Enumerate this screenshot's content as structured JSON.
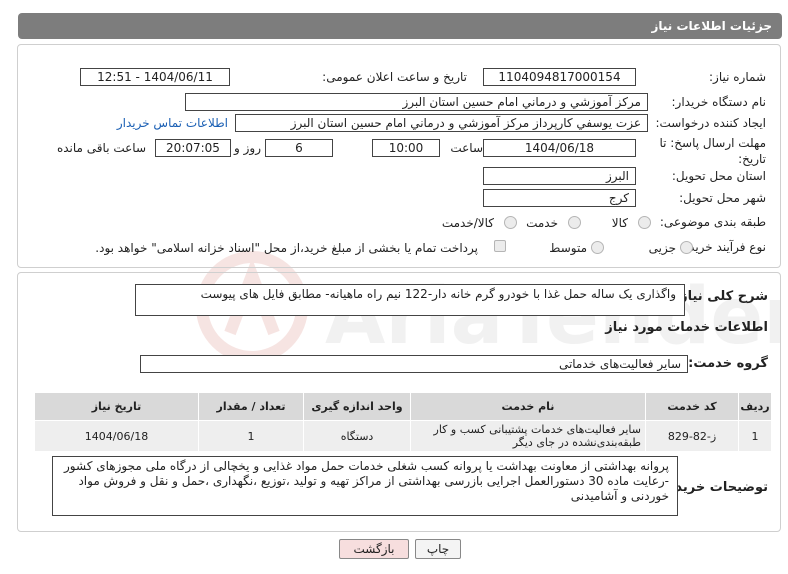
{
  "header": {
    "title": "جزئیات اطلاعات نیاز"
  },
  "fields": {
    "need_number_label": "شماره نیاز:",
    "need_number": "1104094817000154",
    "announce_label": "تاریخ و ساعت اعلان عمومی:",
    "announce_value": "1404/06/11 - 12:51",
    "buyer_org_label": "نام دستگاه خریدار:",
    "buyer_org": "مرکز آموزشي و درماني امام حسين استان البرز",
    "requester_label": "ایجاد کننده درخواست:",
    "requester": "عزت يوسفي كارپرداز مرکز آموزشي و درماني امام حسين استان البرز",
    "contact_link": "اطلاعات تماس خریدار",
    "deadline_label": "مهلت ارسال پاسخ: تا تاریخ:",
    "deadline_date": "1404/06/18",
    "time_label": "ساعت",
    "deadline_time": "10:00",
    "days_value": "6",
    "days_label": "روز و",
    "remaining_time": "20:07:05",
    "remaining_label": "ساعت باقی مانده",
    "province_label": "استان محل تحویل:",
    "province": "البرز",
    "city_label": "شهر محل تحویل:",
    "city": "کرج",
    "category_label": "طبقه بندی موضوعی:",
    "category_options": [
      "کالا",
      "خدمت",
      "کالا/خدمت"
    ],
    "process_label": "نوع فرآیند خرید :",
    "process_options": [
      "جزیی",
      "متوسط"
    ],
    "payment_note": "پرداخت تمام یا بخشی از مبلغ خرید،از محل \"اسناد خزانه اسلامی\" خواهد بود."
  },
  "summary": {
    "label": "شرح کلی نیاز:",
    "text": "واگذاری یک ساله حمل غذا با خودرو گرم خانه دار-122 نیم راه ماهیانه- مطابق فایل های پیوست"
  },
  "services": {
    "section_title": "اطلاعات خدمات مورد نیاز",
    "group_label": "گروه خدمت:",
    "group_value": "سایر فعالیت‌های خدماتی",
    "columns": [
      "ردیف",
      "کد خدمت",
      "نام خدمت",
      "واحد اندازه گیری",
      "تعداد / مقدار",
      "تاریخ نیاز"
    ],
    "rows": [
      {
        "row": "1",
        "code": "ز-82-829",
        "name": "سایر فعالیت‌های خدمات پشتیبانی کسب و کار طبقه‌بندی‌نشده در جای دیگر",
        "unit": "دستگاه",
        "qty": "1",
        "date": "1404/06/18"
      }
    ]
  },
  "buyer_notes": {
    "label": "توضیحات خریدار:",
    "text": "پروانه بهداشتی از معاونت بهداشت یا پروانه کسب شغلی خدمات حمل مواد غذایی و یخچالی از درگاه ملی مجوزهای کشور -رعایت ماده 30 دستورالعمل اجرایی بازرسی بهداشتی از مراکز تهیه و تولید ،توزیع ،نگهداری ،حمل و نقل و فروش مواد خوردنی و آشامیدنی"
  },
  "buttons": {
    "print": "چاپ",
    "back": "بازگشت"
  },
  "watermark": {
    "brand": "AriaTender.neT"
  },
  "colors": {
    "header_bg": "#7d7d7d",
    "link": "#1a5fb4",
    "back_button_bg": "#f7dede",
    "watermark": "#c0392b"
  }
}
